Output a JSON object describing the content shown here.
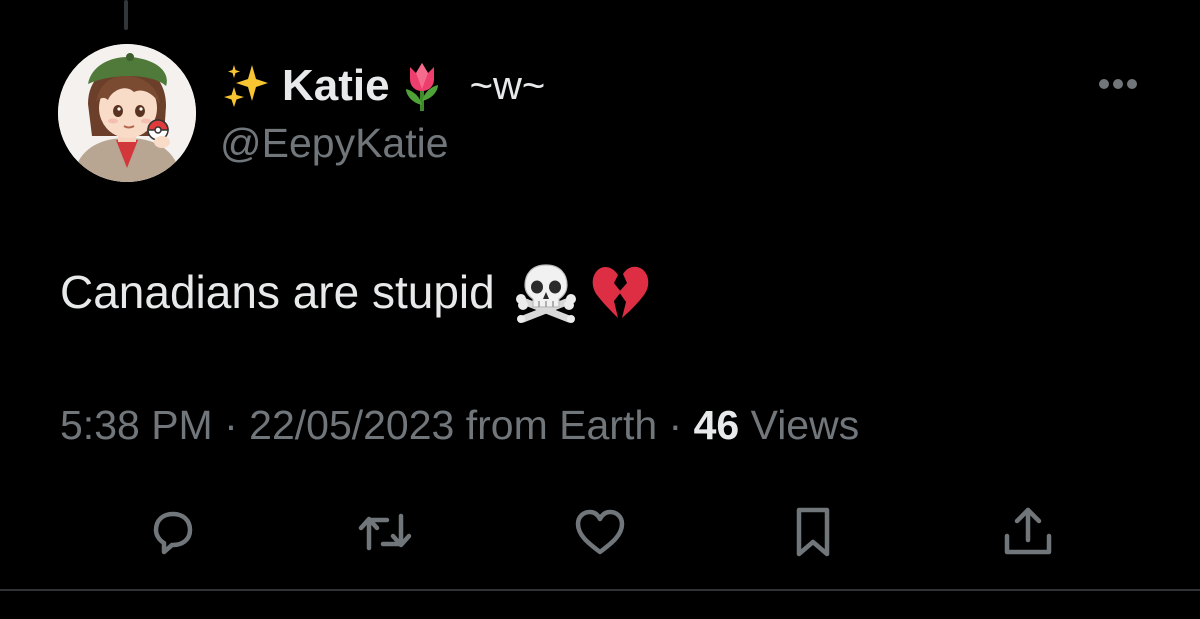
{
  "tweet": {
    "author": {
      "display_name": "Katie",
      "name_prefix_emoji": "sparkles-emoji",
      "name_suffix_emoji": "tulip-emoji",
      "name_suffix": "~w~",
      "handle": "@EepyKatie",
      "avatar": "anime-avatar"
    },
    "text": "Canadians are stupid",
    "text_emojis": [
      "skull-and-crossbones-emoji",
      "broken-heart-emoji"
    ],
    "time": "5:38 PM",
    "separator": " · ",
    "date": "22/05/2023",
    "source": "from Earth",
    "views_count": "46",
    "views_label": "Views"
  },
  "actions": [
    {
      "name": "reply",
      "icon": "speech-bubble-icon"
    },
    {
      "name": "retweet",
      "icon": "retweet-arrows-icon"
    },
    {
      "name": "like",
      "icon": "heart-icon"
    },
    {
      "name": "bookmark",
      "icon": "bookmark-icon"
    },
    {
      "name": "share",
      "icon": "share-upload-icon"
    }
  ],
  "more_menu_icon": "more-dots-icon",
  "colors": {
    "background": "#000000",
    "primary_text": "#e7e9ea",
    "secondary_text": "#71767b",
    "divider": "#2f3336"
  }
}
